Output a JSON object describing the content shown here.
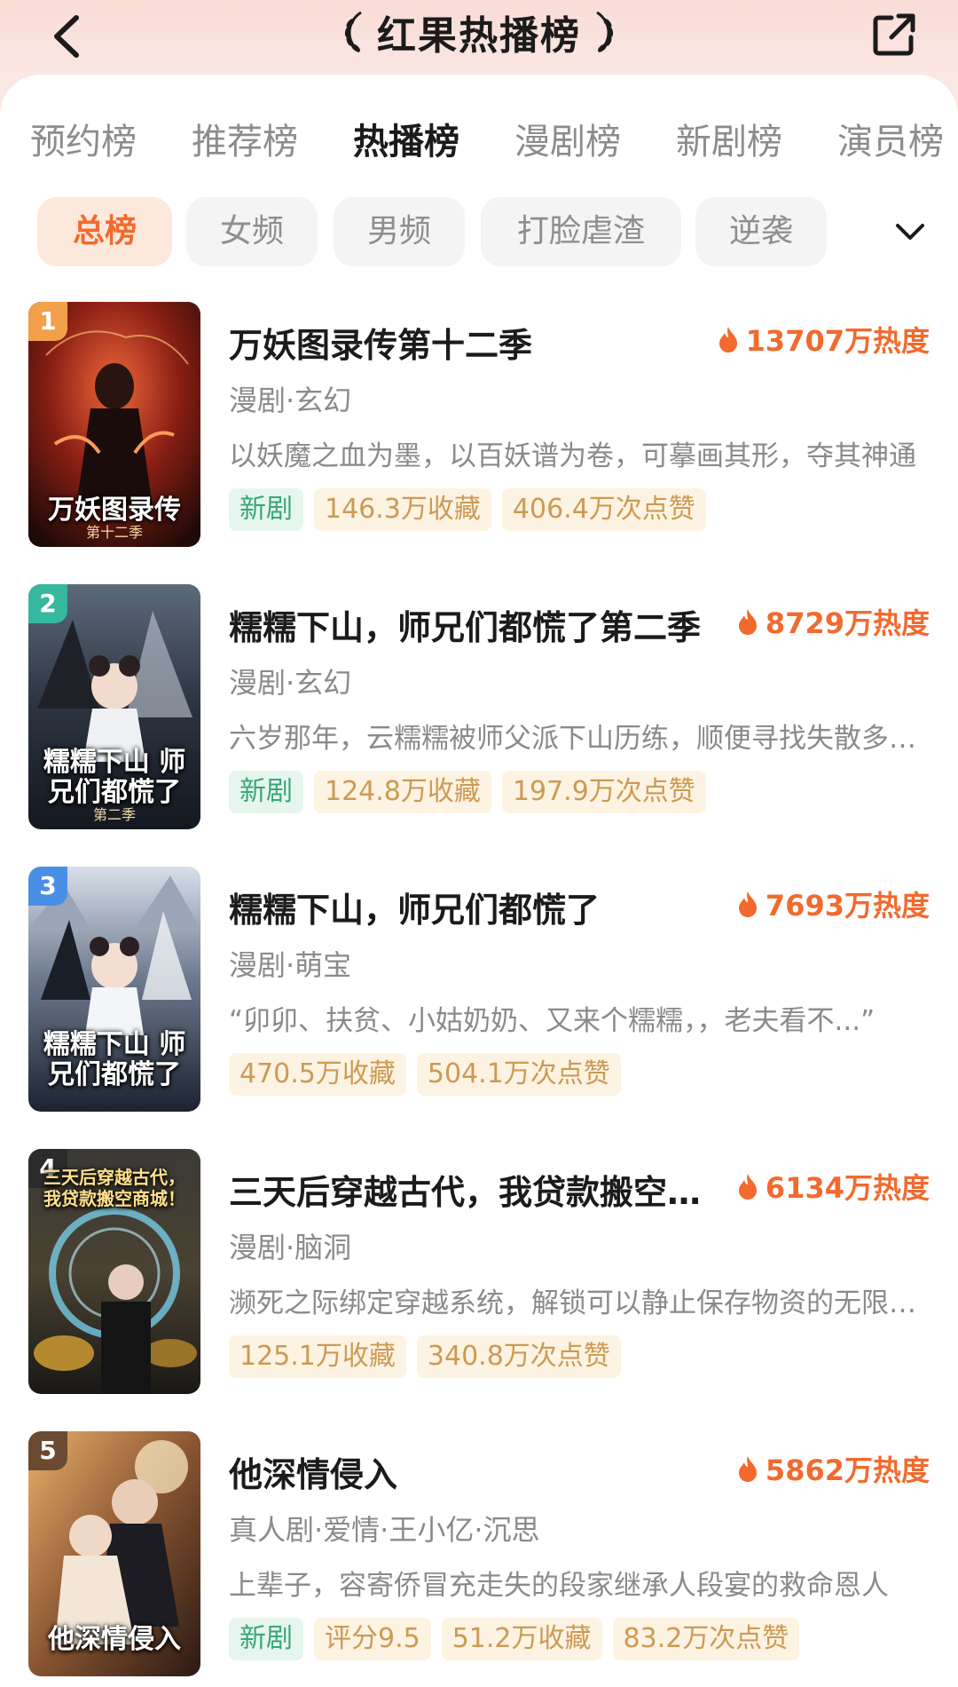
{
  "header": {
    "title": "红果热播榜",
    "back_icon": "chevron-left-icon",
    "share_icon": "share-icon"
  },
  "tabs": [
    "预约榜",
    "推荐榜",
    "热播榜",
    "漫剧榜",
    "新剧榜",
    "演员榜"
  ],
  "active_tab": "热播榜",
  "filters": [
    "总榜",
    "女频",
    "男频",
    "打脸虐渣",
    "逆袭"
  ],
  "active_filter": "总榜",
  "colors": {
    "accent": "#f26a2e",
    "new_badge": "#3aa57c",
    "stat_badge": "#cc9a54",
    "rank1": "#f3a04a",
    "rank2": "#35b7a0",
    "rank3": "#4a8fe6"
  },
  "items": [
    {
      "rank": "1",
      "title": "万妖图录传第十二季",
      "heat": "13707万热度",
      "tags": "漫剧·玄幻",
      "desc": "以妖魔之血为墨，以百妖谱为卷，可摹画其形，夺其神通",
      "badges": [
        "新剧",
        "146.3万收藏",
        "406.4万次点赞"
      ],
      "cover_title": "万妖图录传",
      "cover_sub": "第十二季"
    },
    {
      "rank": "2",
      "title": "糯糯下山，师兄们都慌了第二季",
      "heat": "8729万热度",
      "tags": "漫剧·玄幻",
      "desc": "六岁那年，云糯糯被师父派下山历练，顺便寻找失散多年的师兄们",
      "badges": [
        "新剧",
        "124.8万收藏",
        "197.9万次点赞"
      ],
      "cover_title": "糯糯下山 师兄们都慌了",
      "cover_sub": "第二季"
    },
    {
      "rank": "3",
      "title": "糯糯下山，师兄们都慌了",
      "heat": "7693万热度",
      "tags": "漫剧·萌宝",
      "desc": "“卯卯、扶贫、小姑奶奶、又来个糯糯，，老夫看不...”",
      "badges": [
        "470.5万收藏",
        "504.1万次点赞"
      ],
      "cover_title": "糯糯下山 师兄们都慌了",
      "cover_sub": ""
    },
    {
      "rank": "4",
      "title": "三天后穿越古代，我贷款搬空商城！",
      "heat": "6134万热度",
      "tags": "漫剧·脑洞",
      "desc": "濒死之际绑定穿越系统，解锁可以静止保存物资的无限空间",
      "badges": [
        "125.1万收藏",
        "340.8万次点赞"
      ],
      "cover_title": "三天后穿越古代，我贷款搬空商城！",
      "cover_sub": ""
    },
    {
      "rank": "5",
      "title": "他深情侵入",
      "heat": "5862万热度",
      "tags": "真人剧·爱情·王小亿·沉思",
      "desc": "上辈子，容寄侨冒充走失的段家继承人段宴的救命恩人",
      "badges": [
        "新剧",
        "评分9.5",
        "51.2万收藏",
        "83.2万次点赞"
      ],
      "cover_title": "他深情侵入",
      "cover_sub": ""
    }
  ]
}
